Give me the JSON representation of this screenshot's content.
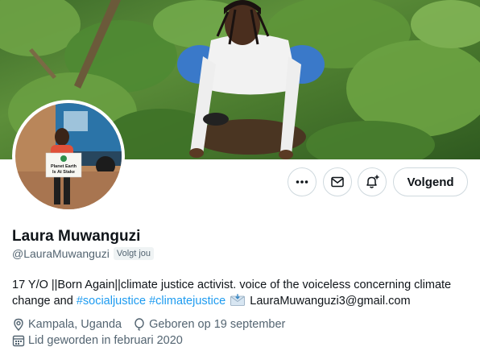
{
  "profile": {
    "name": "Laura Muwanguzi",
    "handle": "@LauraMuwanguzi",
    "follows_you": "Volgt jou",
    "bio": {
      "text1": "17 Y/O ||Born Again||climate justice activist. voice of the voiceless concerning climate change and ",
      "hashtag1": "#socialjustice",
      "hashtag2": "#climatejustice",
      "email": "LauraMuwanguzi3@gmail.com"
    },
    "location": "Kampala, Uganda",
    "birthday": "Geboren op 19 september",
    "joined": "Lid geworden in februari 2020",
    "avatar_sign_text": "Planet Earth Is At Stake"
  },
  "actions": {
    "more_icon": "more-dots-icon",
    "message_icon": "envelope-icon",
    "notify_icon": "bell-plus-icon",
    "follow_label": "Volgend"
  },
  "colors": {
    "link": "#1d9bf0",
    "secondary_text": "#536471",
    "border": "#cfd9de"
  }
}
